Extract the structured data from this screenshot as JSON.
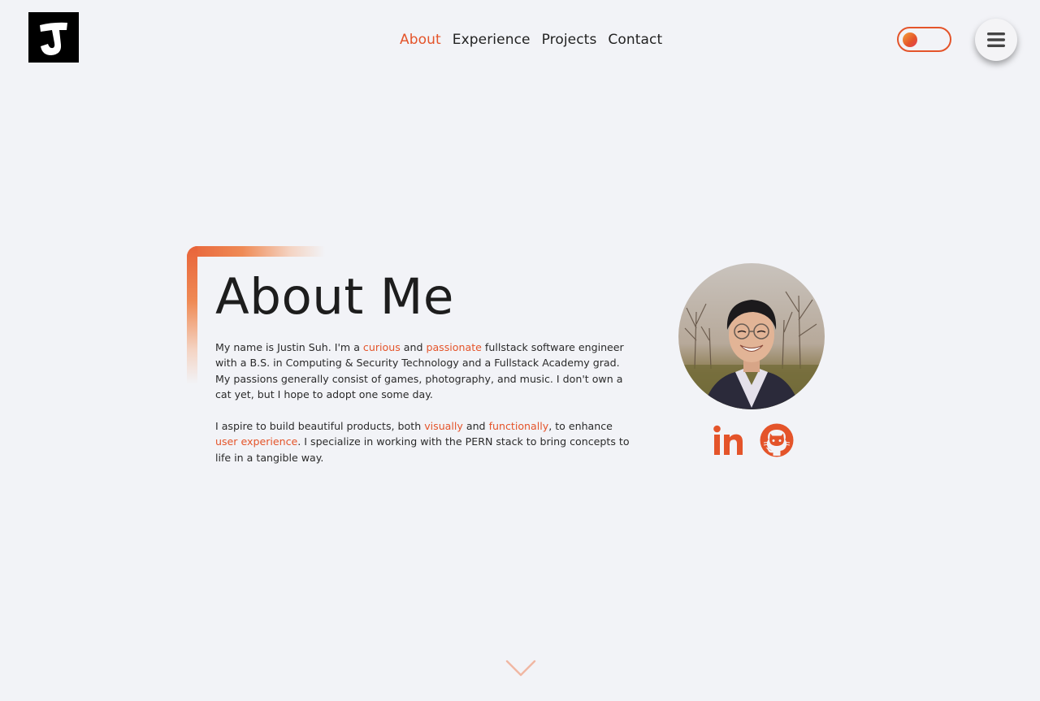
{
  "header": {
    "logo_alt": "J",
    "nav": [
      {
        "label": "About",
        "active": true
      },
      {
        "label": "Experience",
        "active": false
      },
      {
        "label": "Projects",
        "active": false
      },
      {
        "label": "Contact",
        "active": false
      }
    ],
    "theme_toggle": {
      "state": "off"
    },
    "menu_button": {
      "icon": "hamburger-icon"
    }
  },
  "about": {
    "title": "About Me",
    "paragraph1": {
      "t1": "My name is Justin Suh. I'm a ",
      "h1": "curious",
      "t2": " and ",
      "h2": "passionate",
      "t3": " fullstack software engineer with a B.S. in Computing & Security Technology and a Fullstack Academy grad. My passions generally consist of games, photography, and music. I don't own a cat yet, but I hope to adopt one some day."
    },
    "paragraph2": {
      "t1": "I aspire to build beautiful products, both ",
      "h1": "visually",
      "t2": " and ",
      "h2": "functionally",
      "t3": ", to enhance ",
      "h3": "user experience",
      "t4": ". I specialize in working with the PERN stack to bring concepts to life in a tangible way."
    }
  },
  "social": [
    {
      "name": "linkedin",
      "icon": "linkedin-icon"
    },
    {
      "name": "github",
      "icon": "github-icon"
    }
  ],
  "colors": {
    "accent": "#e4542a",
    "background": "#f2f3f7",
    "text": "#1f1f1f"
  },
  "scroll_indicator": {
    "icon": "chevron-down-icon"
  }
}
